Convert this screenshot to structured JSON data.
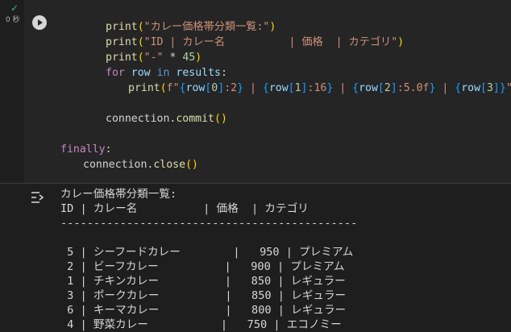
{
  "status": {
    "check": "✓",
    "time": "0 秒"
  },
  "code_lines": [
    {
      "indent": 8,
      "parts": [
        {
          "t": "print",
          "c": "fn"
        },
        {
          "t": "(",
          "c": "brk"
        },
        {
          "t": "\"カレー価格帯分類一覧:\"",
          "c": "str"
        },
        {
          "t": ")",
          "c": "brk"
        }
      ]
    },
    {
      "indent": 8,
      "parts": [
        {
          "t": "print",
          "c": "fn"
        },
        {
          "t": "(",
          "c": "brk"
        },
        {
          "t": "\"ID | カレー名          | 価格  | カテゴリ\"",
          "c": "str"
        },
        {
          "t": ")",
          "c": "brk"
        }
      ]
    },
    {
      "indent": 8,
      "parts": [
        {
          "t": "print",
          "c": "fn"
        },
        {
          "t": "(",
          "c": "brk"
        },
        {
          "t": "\"-\"",
          "c": "str"
        },
        {
          "t": " * ",
          "c": "op"
        },
        {
          "t": "45",
          "c": "num"
        },
        {
          "t": ")",
          "c": "brk"
        }
      ]
    },
    {
      "indent": 8,
      "parts": [
        {
          "t": "for",
          "c": "kw"
        },
        {
          "t": " ",
          "c": "op"
        },
        {
          "t": "row",
          "c": "var"
        },
        {
          "t": " in ",
          "c": "kw2"
        },
        {
          "t": "results",
          "c": "var"
        },
        {
          "t": ":",
          "c": "op"
        }
      ]
    },
    {
      "indent": 12,
      "parts": [
        {
          "t": "print",
          "c": "fn"
        },
        {
          "t": "(",
          "c": "brk"
        },
        {
          "t": "f\"",
          "c": "str"
        },
        {
          "t": "{",
          "c": "brk3"
        },
        {
          "t": "row",
          "c": "var"
        },
        {
          "t": "[",
          "c": "brk3"
        },
        {
          "t": "0",
          "c": "num"
        },
        {
          "t": "]",
          "c": "brk3"
        },
        {
          "t": ":2",
          "c": "str"
        },
        {
          "t": "}",
          "c": "brk3"
        },
        {
          "t": " | ",
          "c": "str"
        },
        {
          "t": "{",
          "c": "brk3"
        },
        {
          "t": "row",
          "c": "var"
        },
        {
          "t": "[",
          "c": "brk3"
        },
        {
          "t": "1",
          "c": "num"
        },
        {
          "t": "]",
          "c": "brk3"
        },
        {
          "t": ":16",
          "c": "str"
        },
        {
          "t": "}",
          "c": "brk3"
        },
        {
          "t": " | ",
          "c": "str"
        },
        {
          "t": "{",
          "c": "brk3"
        },
        {
          "t": "row",
          "c": "var"
        },
        {
          "t": "[",
          "c": "brk3"
        },
        {
          "t": "2",
          "c": "num"
        },
        {
          "t": "]",
          "c": "brk3"
        },
        {
          "t": ":5.0f",
          "c": "str"
        },
        {
          "t": "}",
          "c": "brk3"
        },
        {
          "t": " | ",
          "c": "str"
        },
        {
          "t": "{",
          "c": "brk3"
        },
        {
          "t": "row",
          "c": "var"
        },
        {
          "t": "[",
          "c": "brk3"
        },
        {
          "t": "3",
          "c": "num"
        },
        {
          "t": "]",
          "c": "brk3"
        },
        {
          "t": "}",
          "c": "brk3"
        },
        {
          "t": "\"",
          "c": "str"
        },
        {
          "t": ")",
          "c": "brk"
        }
      ]
    },
    {
      "indent": 0,
      "parts": []
    },
    {
      "indent": 8,
      "parts": [
        {
          "t": "connection",
          "c": "op"
        },
        {
          "t": ".",
          "c": "op"
        },
        {
          "t": "commit",
          "c": "fn"
        },
        {
          "t": "()",
          "c": "brk"
        }
      ]
    },
    {
      "indent": 0,
      "parts": []
    },
    {
      "indent": 0,
      "parts": [
        {
          "t": "finally",
          "c": "kw"
        },
        {
          "t": ":",
          "c": "op"
        }
      ]
    },
    {
      "indent": 4,
      "parts": [
        {
          "t": "connection",
          "c": "op"
        },
        {
          "t": ".",
          "c": "op"
        },
        {
          "t": "close",
          "c": "fn"
        },
        {
          "t": "()",
          "c": "brk"
        }
      ]
    }
  ],
  "output": {
    "lines": [
      "カレー価格帯分類一覧:",
      "ID | カレー名          | 価格  | カテゴリ",
      "---------------------------------------------",
      "",
      " 5 | シーフードカレー        |   950 | プレミアム",
      " 2 | ビーフカレー          |   900 | プレミアム",
      " 1 | チキンカレー          |   850 | レギュラー",
      " 3 | ポークカレー          |   850 | レギュラー",
      " 6 | キーマカレー          |   800 | レギュラー",
      " 4 | 野菜カレー           |   750 | エコノミー"
    ]
  }
}
